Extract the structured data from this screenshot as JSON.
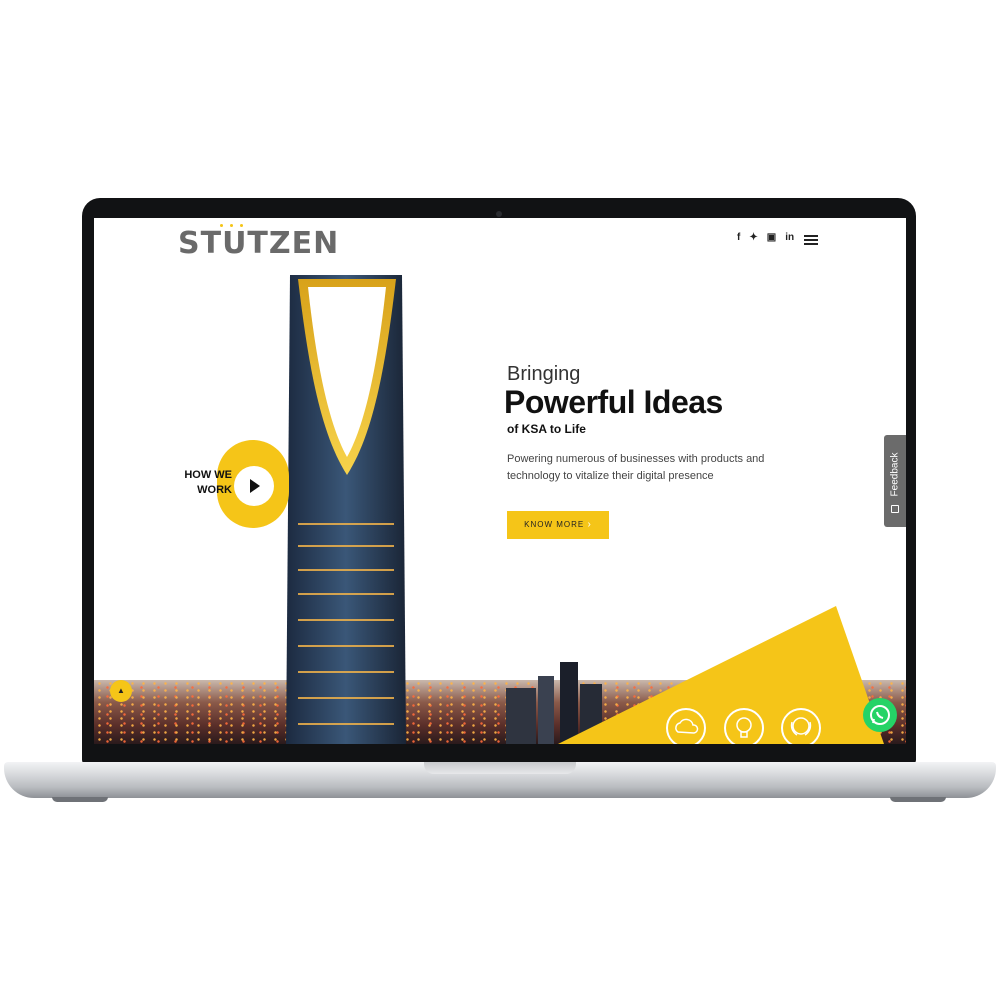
{
  "brand": {
    "logo_text": "STUTZEN",
    "accent_color": "#f5c518"
  },
  "header": {
    "social_icons": [
      "facebook-icon",
      "twitter-icon",
      "instagram-icon",
      "linkedin-icon"
    ],
    "social_glyphs": [
      "f",
      "✦",
      "▣",
      "in"
    ]
  },
  "hero": {
    "intro": "Bringing",
    "headline": "Powerful Ideas",
    "subheadline": "of KSA to Life",
    "description": "Powering numerous of businesses with products and technology to vitalize their digital presence",
    "cta_label": "KNOW MORE",
    "cta_arrow": "›",
    "how_we_work_line1": "HOW WE",
    "how_we_work_line2": "WORK"
  },
  "widgets": {
    "feedback_label": "Feedback",
    "whatsapp_color": "#25d366"
  },
  "features": [
    "cloud-icon",
    "lightbulb-icon",
    "award-icon"
  ]
}
